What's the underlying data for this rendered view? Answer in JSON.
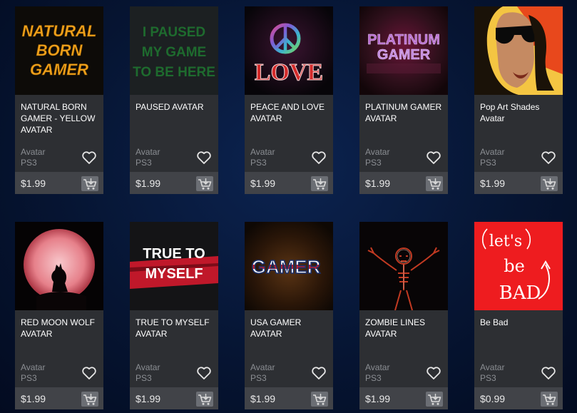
{
  "colors": {
    "background": "#061533",
    "card": "#2d2f33",
    "price_bar": "#414348",
    "muted_text": "#8b8e93"
  },
  "products": [
    {
      "title": "NATURAL BORN GAMER - YELLOW AVATAR",
      "art_text": [
        "NATURAL",
        "BORN",
        "GAMER"
      ],
      "type": "Avatar",
      "platform": "PS3",
      "price": "$1.99",
      "icon": "natural-born-gamer-art"
    },
    {
      "title": "PAUSED AVATAR",
      "art_text": [
        "I PAUSED",
        "MY GAME",
        "TO BE HERE"
      ],
      "type": "Avatar",
      "platform": "PS3",
      "price": "$1.99",
      "icon": "paused-art"
    },
    {
      "title": "PEACE AND LOVE AVATAR",
      "art_text": [
        "LOVE"
      ],
      "type": "Avatar",
      "platform": "PS3",
      "price": "$1.99",
      "icon": "peace-sign-art"
    },
    {
      "title": "PLATINUM GAMER AVATAR",
      "art_text": [
        "PLATINUM",
        "GAMER"
      ],
      "type": "Avatar",
      "platform": "PS3",
      "price": "$1.99",
      "icon": "platinum-gamer-art"
    },
    {
      "title": "Pop Art Shades Avatar",
      "art_text": [],
      "type": "Avatar",
      "platform": "PS3",
      "price": "$1.99",
      "icon": "pop-art-face-art"
    },
    {
      "title": "RED MOON WOLF AVATAR",
      "art_text": [],
      "type": "Avatar",
      "platform": "PS3",
      "price": "$1.99",
      "icon": "red-moon-wolf-art"
    },
    {
      "title": "TRUE TO MYSELF AVATAR",
      "art_text": [
        "TRUE TO",
        "MYSELF"
      ],
      "type": "Avatar",
      "platform": "PS3",
      "price": "$1.99",
      "icon": "true-to-myself-art"
    },
    {
      "title": "USA GAMER AVATAR",
      "art_text": [
        "GAMER"
      ],
      "type": "Avatar",
      "platform": "PS3",
      "price": "$1.99",
      "icon": "usa-gamer-art"
    },
    {
      "title": "ZOMBIE LINES AVATAR",
      "art_text": [],
      "type": "Avatar",
      "platform": "PS3",
      "price": "$1.99",
      "icon": "zombie-art"
    },
    {
      "title": "Be Bad",
      "art_text": [
        "let's",
        "be",
        "BAD"
      ],
      "type": "Avatar",
      "platform": "PS3",
      "price": "$0.99",
      "icon": "lets-be-bad-art"
    }
  ]
}
